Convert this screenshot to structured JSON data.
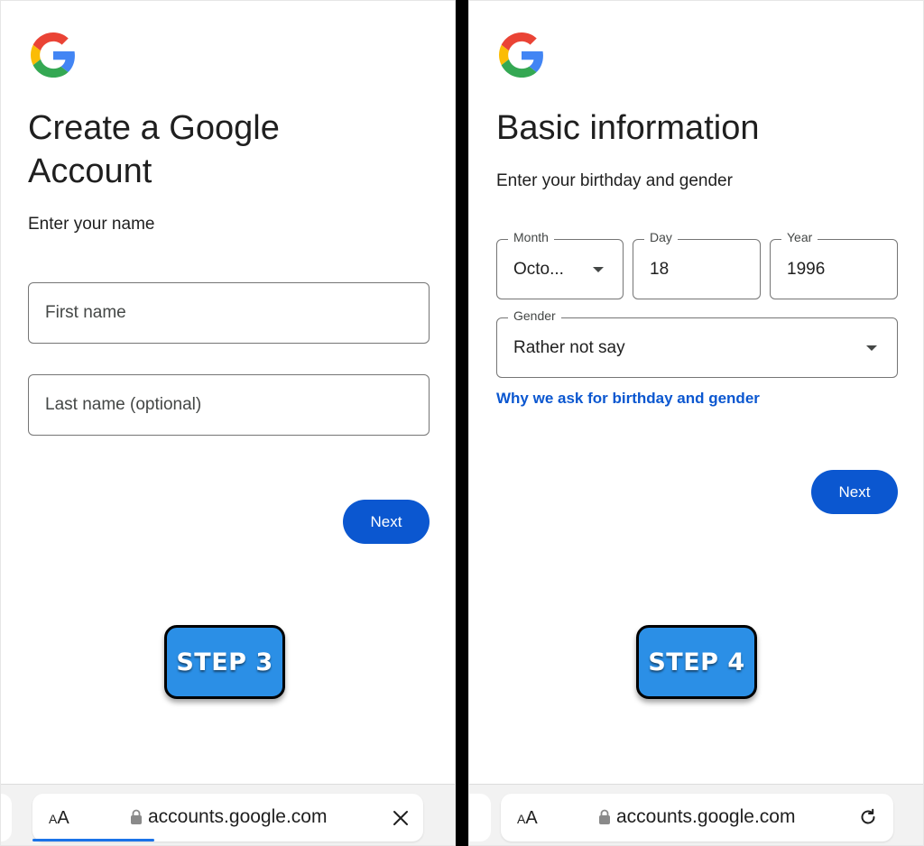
{
  "left": {
    "title": "Create a Google Account",
    "subtitle": "Enter your name",
    "first_name": {
      "placeholder": "First name"
    },
    "last_name": {
      "placeholder": "Last name (optional)"
    },
    "next_label": "Next",
    "step_label": "STEP 3",
    "address_bar": {
      "aa_label": "AA",
      "url": "accounts.google.com",
      "action_icon": "close-icon",
      "load_progress": 0.3
    }
  },
  "right": {
    "title": "Basic information",
    "subtitle": "Enter your birthday and gender",
    "month": {
      "label": "Month",
      "value": "Octo..."
    },
    "day": {
      "label": "Day",
      "value": "18"
    },
    "year": {
      "label": "Year",
      "value": "1996"
    },
    "gender": {
      "label": "Gender",
      "value": "Rather not say"
    },
    "why_link": "Why we ask for birthday and gender",
    "next_label": "Next",
    "step_label": "STEP 4",
    "address_bar": {
      "aa_label": "AA",
      "url": "accounts.google.com",
      "action_icon": "reload-icon"
    }
  },
  "colors": {
    "primary_button": "#0b57d0",
    "link": "#0b57d0",
    "step_badge": "#2b8fe6",
    "google_blue": "#4285F4",
    "google_red": "#EA4335",
    "google_yellow": "#FBBC05",
    "google_green": "#34A853"
  }
}
